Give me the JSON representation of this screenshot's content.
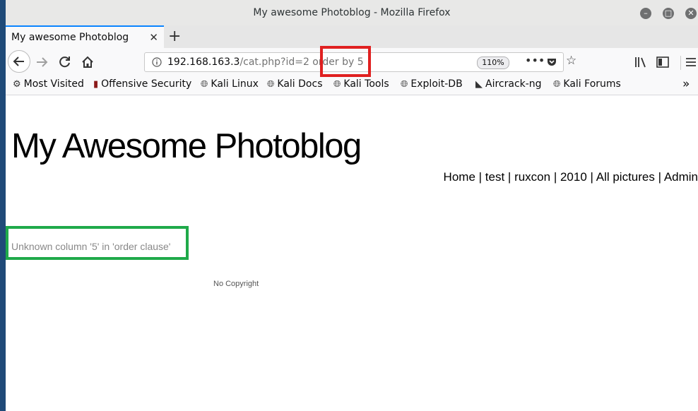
{
  "window": {
    "title": "My awesome Photoblog - Mozilla Firefox"
  },
  "tabs": [
    {
      "label": "My awesome Photoblog",
      "close": "✕"
    }
  ],
  "new_tab_label": "+",
  "url": {
    "host": "192.168.163.3",
    "path": "/cat.php?id=2 order by 5",
    "zoom": "110%"
  },
  "bookmarks": [
    {
      "label": "Most Visited",
      "icon": "gear-icon"
    },
    {
      "label": "Offensive Security",
      "icon": "offsec-icon"
    },
    {
      "label": "Kali Linux",
      "icon": "globe-icon"
    },
    {
      "label": "Kali Docs",
      "icon": "globe-icon"
    },
    {
      "label": "Kali Tools",
      "icon": "globe-icon"
    },
    {
      "label": "Exploit-DB",
      "icon": "globe-icon"
    },
    {
      "label": "Aircrack-ng",
      "icon": "aircrack-icon"
    },
    {
      "label": "Kali Forums",
      "icon": "globe-icon"
    }
  ],
  "page": {
    "site_title": "My Awesome Photoblog",
    "nav": [
      "Home",
      "test",
      "ruxcon",
      "2010",
      "All pictures",
      "Admin"
    ],
    "error": "Unknown column '5' in 'order clause'",
    "footer": "No Copyright"
  },
  "colors": {
    "highlight_red": "#e02020",
    "highlight_green": "#1faa4a",
    "tab_accent": "#0a84ff"
  }
}
